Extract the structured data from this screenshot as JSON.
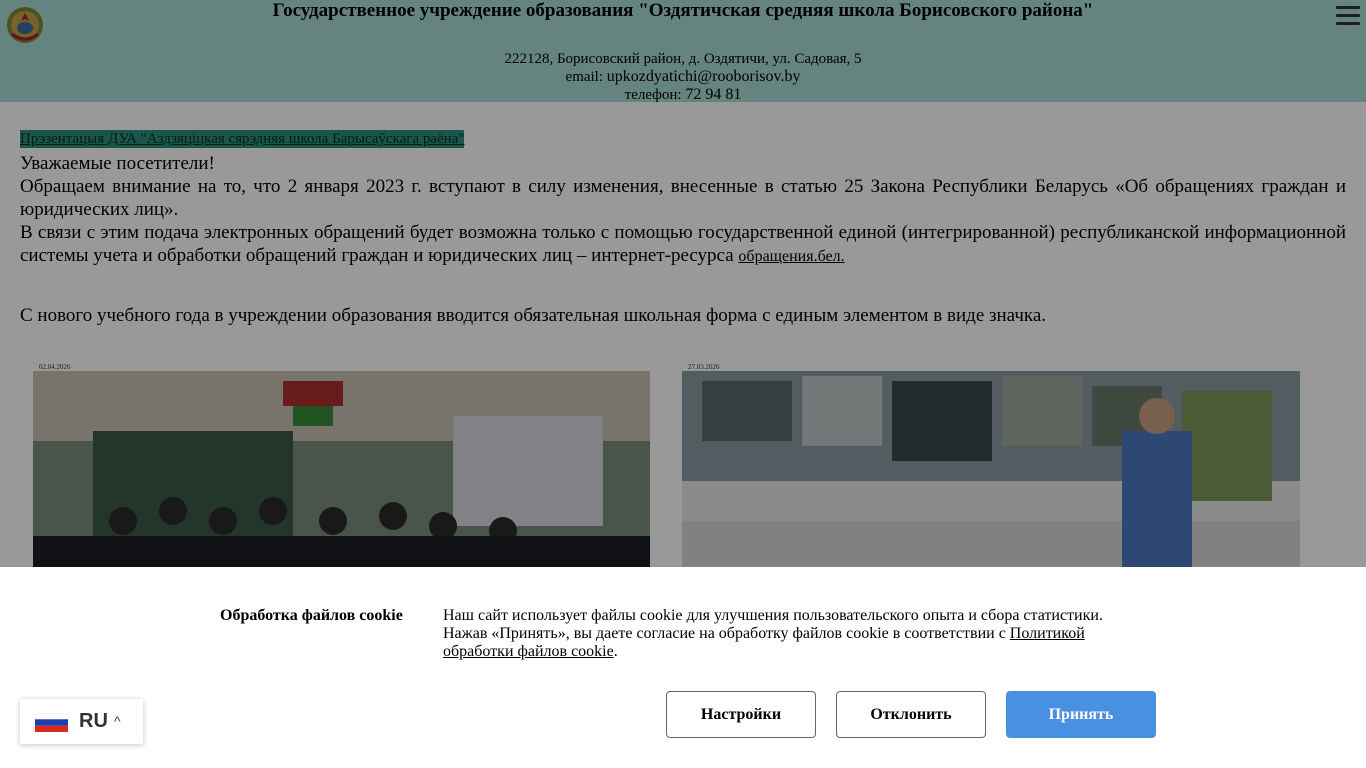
{
  "header": {
    "title": "Государственное учреждение образования \"Оздятичская средняя школа Борисовского района\"",
    "address": "222128, Борисовский район, д. Оздятичи, ул. Садовая, 5",
    "email_label": "email:",
    "email_value": "upkozdyatichi@rooborisov.by",
    "phone_label": "телефон:",
    "phone_value": "72 94 81"
  },
  "content": {
    "promo_link": "Прэзентацыя ДУА \"Аздзяцiцкая сярэдняя школа Барысаўскага раёна\"",
    "greeting": "Уважаемые посетители!",
    "paragraph1": "Обращаем внимание на то, что 2 января 2023 г. вступают в силу изменения, внесенные в статью 25 Закона Республики Беларусь «Об обращениях граждан и юридических лиц».",
    "paragraph2": "В связи с этим подача электронных обращений будет возможна только с помощью государственной единой (интегрированной) республиканской информационной системы учета и обработки обращений граждан и юридических лиц – интернет-ресурса",
    "paragraph2_link": "обращения.бел.",
    "uniform_note": "С нового учебного года в учреждении образования вводится обязательная школьная форма с единым элементом в виде значка."
  },
  "gallery": [
    {
      "date": "02.04.2026"
    },
    {
      "date": "27.03.2026"
    }
  ],
  "cookie": {
    "title": "Обработка файлов cookie",
    "text_line1": "Наш сайт использует файлы cookie для улучшения пользовательского опыта и сбора статистики.",
    "text_line2": "Нажав «Принять», вы даете согласие на обработку файлов cookie в соответствии с",
    "policy_link": "Политикой обработки файлов cookie",
    "text_end": ".",
    "settings_label": "Настройки",
    "decline_label": "Отклонить",
    "accept_label": "Принять"
  },
  "language": {
    "code": "RU",
    "caret": "^"
  },
  "colors": {
    "header_bg": "#a8dcd6",
    "accent_blue": "#4a90e2",
    "link_highlight": "#2c8f7e"
  }
}
